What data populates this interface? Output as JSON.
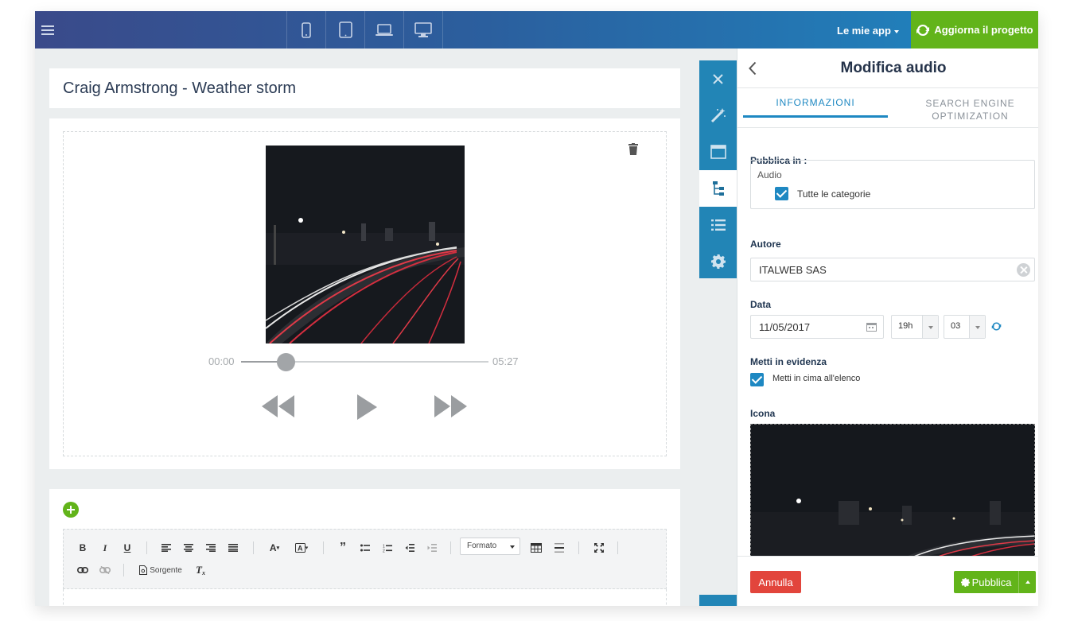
{
  "topbar": {
    "apps_label": "Le mie app",
    "update_label": "Aggiorna il progetto",
    "devices": [
      "mobile-icon",
      "tablet-icon",
      "laptop-icon",
      "desktop-icon"
    ],
    "colors": {
      "bar_start": "#3a4a8a",
      "bar_end": "#1e88c2",
      "update_bg": "#62b41a"
    }
  },
  "editor": {
    "title": "Craig Armstrong - Weather storm",
    "player": {
      "time_current": "00:00",
      "time_total": "05:27",
      "progress": 0.18
    },
    "toolbar": {
      "format_label": "Formato",
      "source_label": "Sorgente"
    }
  },
  "rail": {
    "items": [
      "close-icon",
      "magic-wand-icon",
      "layout-icon",
      "tree-icon",
      "list-icon",
      "gear-icon"
    ],
    "active": "tree-icon"
  },
  "panel": {
    "title": "Modifica audio",
    "tabs": [
      {
        "label": "INFORMAZIONI"
      },
      {
        "label": "SEARCH ENGINE OPTIMIZATION"
      }
    ],
    "publish_in": {
      "label": "Pubblica in :",
      "section": "Audio",
      "category_label": "Tutte le categorie",
      "checked": true
    },
    "author": {
      "label": "Autore",
      "value": "ITALWEB SAS"
    },
    "date": {
      "label": "Data",
      "value": "11/05/2017",
      "hour": "19h",
      "minute": "03"
    },
    "featured": {
      "label": "Metti in evidenza",
      "option": "Metti in cima all'elenco",
      "checked": true
    },
    "icon": {
      "label": "Icona"
    },
    "cancel_label": "Annulla",
    "publish_label": "Pubblica"
  }
}
